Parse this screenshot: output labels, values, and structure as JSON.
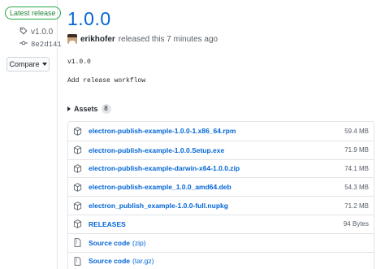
{
  "sidebar": {
    "badge": "Latest release",
    "tag": "v1.0.0",
    "commit": "8e2d141",
    "compare_label": "Compare"
  },
  "release": {
    "title": "1.0.0",
    "author": "erikhofer",
    "released_text": "released this 7 minutes ago",
    "version_text": "v1.0.0",
    "commit_message": "Add release workflow"
  },
  "assets": {
    "label": "Assets",
    "count": "8",
    "files": [
      {
        "name": "electron-publish-example-1.0.0-1.x86_64.rpm",
        "size": "59.4 MB"
      },
      {
        "name": "electron-publish-example-1.0.0.Setup.exe",
        "size": "71.9 MB"
      },
      {
        "name": "electron-publish-example-darwin-x64-1.0.0.zip",
        "size": "74.1 MB"
      },
      {
        "name": "electron-publish-example_1.0.0_amd64.deb",
        "size": "54.3 MB"
      },
      {
        "name": "electron_publish_example-1.0.0-full.nupkg",
        "size": "71.2 MB"
      },
      {
        "name": "RELEASES",
        "size": "94 Bytes"
      }
    ],
    "source": [
      {
        "label": "Source code",
        "format": "(zip)"
      },
      {
        "label": "Source code",
        "format": "(tar.gz)"
      }
    ]
  },
  "icons": {
    "tag": "tag-icon",
    "commit": "git-commit-icon",
    "package": "package-icon",
    "file_zip": "file-zip-icon"
  },
  "colors": {
    "link": "#0366d6",
    "badge_green": "#28a745",
    "muted": "#586069",
    "border": "#e1e4e8"
  }
}
